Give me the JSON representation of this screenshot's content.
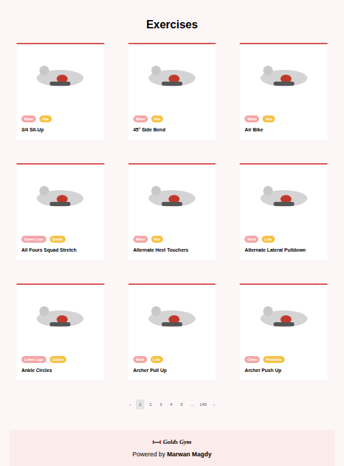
{
  "page": {
    "title": "Exercises"
  },
  "exercises": [
    {
      "name": "3/4 Sit-Up",
      "bodyPart": "Waist",
      "target": "Abs"
    },
    {
      "name": "45° Side Bend",
      "bodyPart": "Waist",
      "target": "Abs"
    },
    {
      "name": "Air Bike",
      "bodyPart": "Waist",
      "target": "Abs"
    },
    {
      "name": "All Fours Squad Stretch",
      "bodyPart": "Upper Legs",
      "target": "Quads"
    },
    {
      "name": "Alternate Heel Touchers",
      "bodyPart": "Waist",
      "target": "Abs"
    },
    {
      "name": "Alternate Lateral Pulldown",
      "bodyPart": "Back",
      "target": "Lats"
    },
    {
      "name": "Ankle Circles",
      "bodyPart": "Lower Legs",
      "target": "Calves"
    },
    {
      "name": "Archer Pull Up",
      "bodyPart": "Back",
      "target": "Lats"
    },
    {
      "name": "Archer Push Up",
      "bodyPart": "Chest",
      "target": "Pectorals"
    }
  ],
  "pagination": [
    {
      "label": "‹",
      "selected": false
    },
    {
      "label": "1",
      "selected": true
    },
    {
      "label": "2",
      "selected": false
    },
    {
      "label": "3",
      "selected": false
    },
    {
      "label": "4",
      "selected": false
    },
    {
      "label": "5",
      "selected": false
    },
    {
      "label": "...",
      "selected": false
    },
    {
      "label": "146",
      "selected": false
    },
    {
      "label": "›",
      "selected": false
    }
  ],
  "footer": {
    "logo": "Golds Gym",
    "powered": "Powered by",
    "author": "Marwan Magdy"
  }
}
